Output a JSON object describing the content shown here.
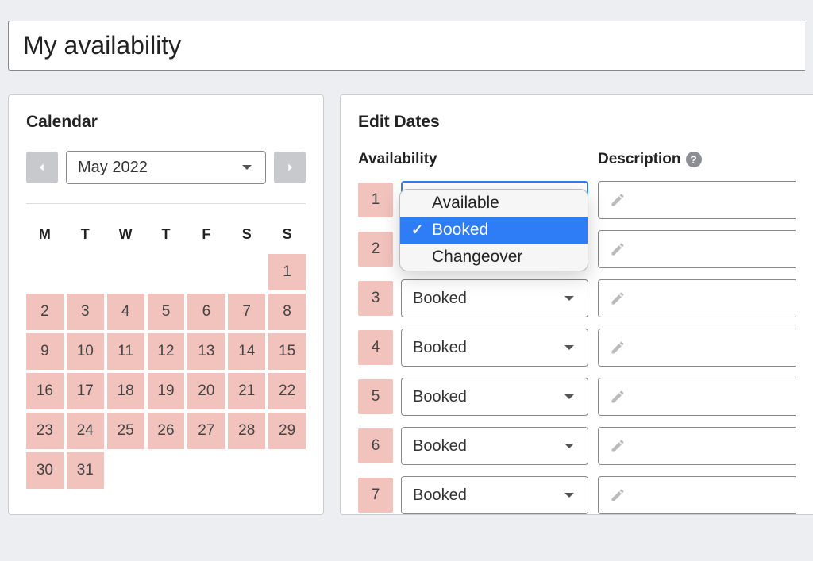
{
  "title": "My availability",
  "calendar": {
    "panel_title": "Calendar",
    "month_label": "May 2022",
    "dow": [
      "M",
      "T",
      "W",
      "T",
      "F",
      "S",
      "S"
    ],
    "weeks": [
      [
        null,
        null,
        null,
        null,
        null,
        null,
        {
          "n": 1,
          "booked": true
        }
      ],
      [
        {
          "n": 2,
          "booked": true
        },
        {
          "n": 3,
          "booked": true
        },
        {
          "n": 4,
          "booked": true
        },
        {
          "n": 5,
          "booked": true
        },
        {
          "n": 6,
          "booked": true
        },
        {
          "n": 7,
          "booked": true
        },
        {
          "n": 8,
          "booked": true
        }
      ],
      [
        {
          "n": 9,
          "booked": true
        },
        {
          "n": 10,
          "booked": true
        },
        {
          "n": 11,
          "booked": true
        },
        {
          "n": 12,
          "booked": true
        },
        {
          "n": 13,
          "booked": true
        },
        {
          "n": 14,
          "booked": true
        },
        {
          "n": 15,
          "booked": true
        }
      ],
      [
        {
          "n": 16,
          "booked": true
        },
        {
          "n": 17,
          "booked": true
        },
        {
          "n": 18,
          "booked": true
        },
        {
          "n": 19,
          "booked": true
        },
        {
          "n": 20,
          "booked": true
        },
        {
          "n": 21,
          "booked": true
        },
        {
          "n": 22,
          "booked": true
        }
      ],
      [
        {
          "n": 23,
          "booked": true
        },
        {
          "n": 24,
          "booked": true
        },
        {
          "n": 25,
          "booked": true
        },
        {
          "n": 26,
          "booked": true
        },
        {
          "n": 27,
          "booked": true
        },
        {
          "n": 28,
          "booked": true
        },
        {
          "n": 29,
          "booked": true
        }
      ],
      [
        {
          "n": 30,
          "booked": true
        },
        {
          "n": 31,
          "booked": true
        },
        null,
        null,
        null,
        null,
        null
      ]
    ]
  },
  "edit": {
    "panel_title": "Edit Dates",
    "col_availability": "Availability",
    "col_description": "Description",
    "rows": [
      {
        "day": "1",
        "value": "Booked",
        "open": true
      },
      {
        "day": "2",
        "value": "Booked"
      },
      {
        "day": "3",
        "value": "Booked"
      },
      {
        "day": "4",
        "value": "Booked"
      },
      {
        "day": "5",
        "value": "Booked"
      },
      {
        "day": "6",
        "value": "Booked"
      },
      {
        "day": "7",
        "value": "Booked"
      }
    ],
    "dropdown_options": [
      "Available",
      "Booked",
      "Changeover"
    ],
    "dropdown_selected": "Booked"
  }
}
